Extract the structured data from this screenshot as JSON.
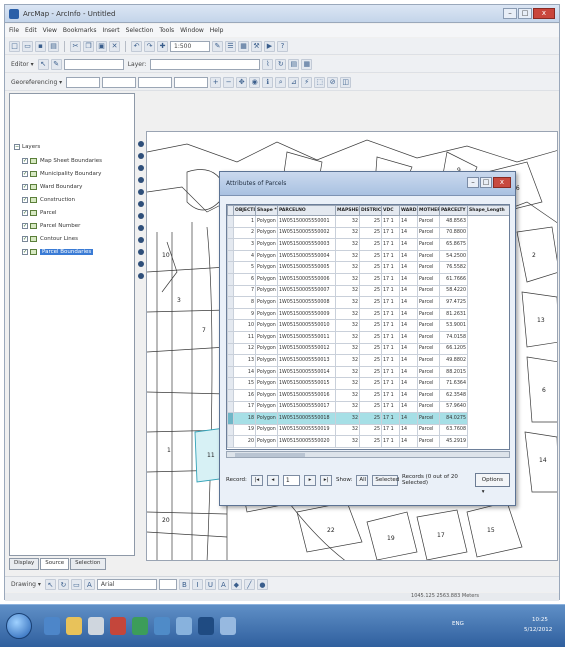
{
  "window": {
    "title": "ArcMap - ArcInfo - Untitled",
    "buttons": {
      "minimize": "–",
      "maximize": "□",
      "close": "x"
    }
  },
  "menu": [
    "File",
    "Edit",
    "View",
    "Bookmarks",
    "Insert",
    "Selection",
    "Tools",
    "Window",
    "Help"
  ],
  "toolbar": {
    "scale": "1:500",
    "editor_label": "Editor ▾",
    "layer_combo": "Layer:",
    "georef_label": "Georeferencing ▾",
    "draw_label": "Drawing ▾",
    "font_combo": "Arial"
  },
  "toc": {
    "root": "Layers",
    "layers": [
      "Map Sheet Boundaries",
      "Municipality Boundary",
      "Ward Boundary",
      "Construction",
      "Parcel",
      "Parcel Number",
      "Contour Lines",
      "Parcel Boundaries"
    ],
    "selected_index": 7,
    "tabs": [
      "Display",
      "Source",
      "Selection"
    ]
  },
  "dialog": {
    "title": "Attributes of Parcels",
    "columns": [
      "OBJECTID *",
      "Shape *",
      "PARCELNO",
      "MAPSHEET",
      "DISTRICT",
      "VDC",
      "WARD",
      "MOTHER",
      "PARCELTY",
      "Shape_Length"
    ],
    "rows": [
      [
        "1",
        "Polygon",
        "1W05150005550001",
        "32",
        "25",
        "17 1",
        "14",
        "Parcel",
        "48.8563"
      ],
      [
        "2",
        "Polygon",
        "1W05150005550002",
        "32",
        "25",
        "17 1",
        "14",
        "Parcel",
        "70.8800"
      ],
      [
        "3",
        "Polygon",
        "1W05150005550003",
        "32",
        "25",
        "17 1",
        "14",
        "Parcel",
        "65.8675"
      ],
      [
        "4",
        "Polygon",
        "1W05150005550004",
        "32",
        "25",
        "17 1",
        "14",
        "Parcel",
        "54.2500"
      ],
      [
        "5",
        "Polygon",
        "1W05150005550005",
        "32",
        "25",
        "17 1",
        "14",
        "Parcel",
        "76.5582"
      ],
      [
        "6",
        "Polygon",
        "1W05150005550006",
        "32",
        "25",
        "17 1",
        "14",
        "Parcel",
        "61.7666"
      ],
      [
        "7",
        "Polygon",
        "1W05150005550007",
        "32",
        "25",
        "17 1",
        "14",
        "Parcel",
        "58.4220"
      ],
      [
        "8",
        "Polygon",
        "1W05150005550008",
        "32",
        "25",
        "17 1",
        "14",
        "Parcel",
        "97.4725"
      ],
      [
        "9",
        "Polygon",
        "1W05150005550009",
        "32",
        "25",
        "17 1",
        "14",
        "Parcel",
        "81.2631"
      ],
      [
        "10",
        "Polygon",
        "1W05150005550010",
        "32",
        "25",
        "17 1",
        "14",
        "Parcel",
        "53.9001"
      ],
      [
        "11",
        "Polygon",
        "1W05150005550011",
        "32",
        "25",
        "17 1",
        "14",
        "Parcel",
        "74.0158"
      ],
      [
        "12",
        "Polygon",
        "1W05150005550012",
        "32",
        "25",
        "17 1",
        "14",
        "Parcel",
        "66.1205"
      ],
      [
        "13",
        "Polygon",
        "1W05150005550013",
        "32",
        "25",
        "17 1",
        "14",
        "Parcel",
        "49.8802"
      ],
      [
        "14",
        "Polygon",
        "1W05150005550014",
        "32",
        "25",
        "17 1",
        "14",
        "Parcel",
        "88.2015"
      ],
      [
        "15",
        "Polygon",
        "1W05150005550015",
        "32",
        "25",
        "17 1",
        "14",
        "Parcel",
        "71.6364"
      ],
      [
        "16",
        "Polygon",
        "1W05150005550016",
        "32",
        "25",
        "17 1",
        "14",
        "Parcel",
        "62.3548"
      ],
      [
        "17",
        "Polygon",
        "1W05150005550017",
        "32",
        "25",
        "17 1",
        "14",
        "Parcel",
        "57.9640"
      ],
      [
        "18",
        "Polygon",
        "1W05150005550018",
        "32",
        "25",
        "17 1",
        "14",
        "Parcel",
        "84.0275"
      ],
      [
        "19",
        "Polygon",
        "1W05150005550019",
        "32",
        "25",
        "17 1",
        "14",
        "Parcel",
        "63.7608"
      ],
      [
        "20",
        "Polygon",
        "1W05150005550020",
        "32",
        "25",
        "17 1",
        "14",
        "Parcel",
        "45.2919"
      ]
    ],
    "highlight_row": 17,
    "footer": {
      "record_label": "Record:",
      "record_value": "1",
      "show_label": "Show:",
      "show_all": "All",
      "show_selected": "Selected",
      "count_text": "Records (0 out of 20 Selected)",
      "options": "Options ▾"
    }
  },
  "status": {
    "coordinates": "1045.125  2563.883 Meters"
  },
  "taskbar": {
    "clock_time": "10:25",
    "clock_date": "5/12/2012",
    "tray": "ENG"
  }
}
